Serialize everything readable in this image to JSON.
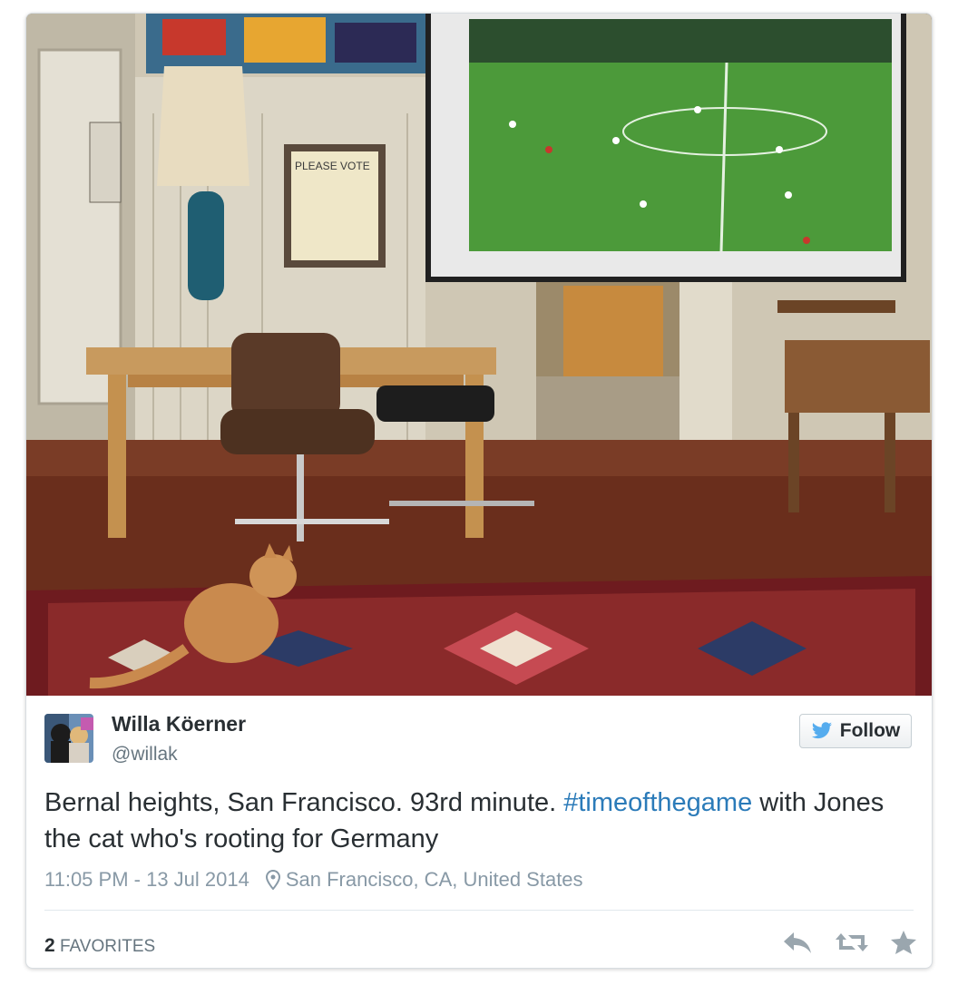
{
  "tweet": {
    "author_name": "Willa Köerner",
    "author_handle": "@willak",
    "follow_label": "Follow",
    "text_before": "Bernal heights, San Francisco. 93rd minute. ",
    "hashtag": "#timeofthegame",
    "text_after": " with Jones the cat who's rooting for Germany",
    "timestamp": "11:05 PM - 13 Jul 2014",
    "location": "San Francisco, CA, United States",
    "favorites_count": "2",
    "favorites_label": "FAVORITES"
  },
  "icons": {
    "follow": "twitter-bird-icon",
    "location": "location-pin-icon",
    "reply": "reply-icon",
    "retweet": "retweet-icon",
    "favorite": "star-icon"
  },
  "colors": {
    "hashtag": "#2b7bb9",
    "brand": "#55acee",
    "text": "#292f33",
    "muted": "#8899a6"
  }
}
